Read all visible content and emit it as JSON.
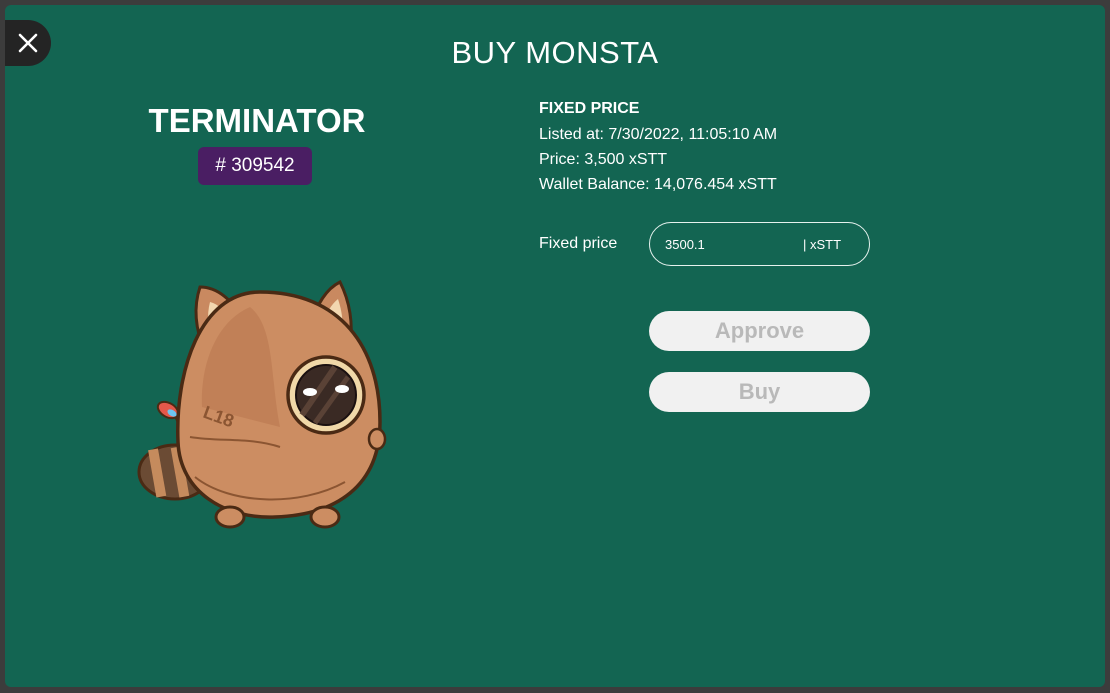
{
  "modal": {
    "title": "BUY MONSTA",
    "close_icon": "close-icon"
  },
  "monster": {
    "name": "TERMINATOR",
    "id_label": "# 309542",
    "image_text": "L18"
  },
  "listing": {
    "heading": "FIXED PRICE",
    "listed_at": "Listed at: 7/30/2022, 11:05:10 AM",
    "price": "Price: 3,500 xSTT",
    "wallet_balance": "Wallet Balance: 14,076.454 xSTT"
  },
  "price_input": {
    "label": "Fixed price",
    "value": "3500.1",
    "unit": "| xSTT"
  },
  "actions": {
    "approve_label": "Approve",
    "buy_label": "Buy"
  },
  "colors": {
    "background": "#136552",
    "badge": "#4a1e63",
    "button_bg": "#f1f1f1",
    "button_text": "#b9b9b9"
  }
}
